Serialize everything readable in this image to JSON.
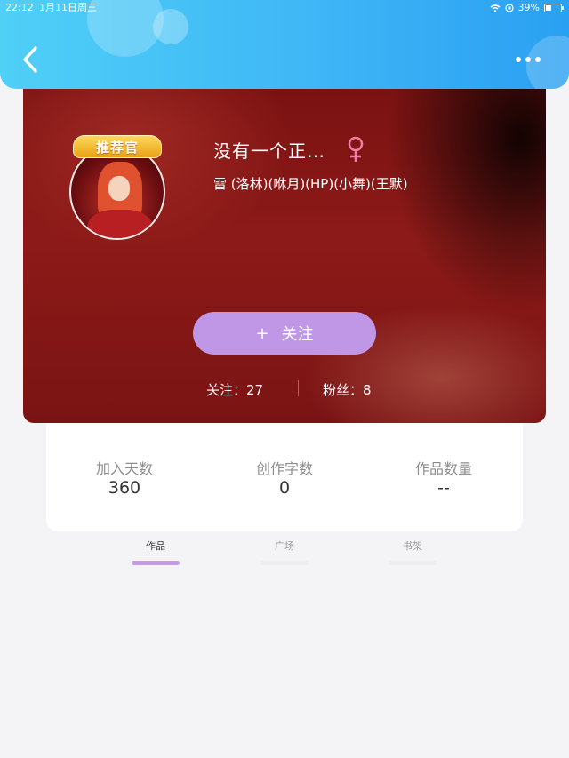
{
  "status_bar": {
    "time": "22:12",
    "date": "1月11日周三",
    "battery": "39%"
  },
  "header": {
    "back_icon": "chevron-left-icon",
    "more_icon": "more-dots-icon",
    "color_start": "#4fd0f7",
    "color_end": "#2aa0f2"
  },
  "profile": {
    "badge": "推荐官",
    "nickname": "没有一个正…",
    "gender_symbol": "♀",
    "gender_color": "#f07fa6",
    "signature": "雷 (洛林)(咻月)(HP)(小舞)(王默)",
    "follow_button": {
      "icon": "+",
      "label": "关注",
      "color": "#c097e6"
    },
    "following_text": "关注：27",
    "fans_text": "粉丝：8"
  },
  "stats": [
    {
      "label": "加入天数",
      "value": "360"
    },
    {
      "label": "创作字数",
      "value": "0"
    },
    {
      "label": "作品数量",
      "value": "--"
    }
  ],
  "tabs": [
    {
      "label": "作品",
      "active": true
    },
    {
      "label": "广场",
      "active": false
    },
    {
      "label": "书架",
      "active": false
    }
  ],
  "accent_color": "#c49be8"
}
